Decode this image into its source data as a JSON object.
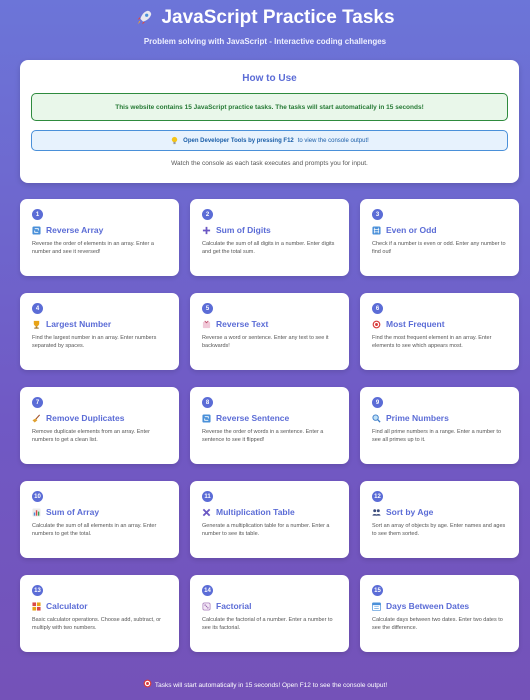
{
  "header": {
    "title": "JavaScript Practice Tasks",
    "subtitle": "Problem solving with JavaScript - Interactive coding challenges"
  },
  "how_to": {
    "heading": "How to Use",
    "notice": "This website contains 15 JavaScript practice tasks. The tasks will start automatically in 15 seconds!",
    "devtools_strong": "Open Developer Tools by pressing F12",
    "devtools_rest": "to view the console output!",
    "watch": "Watch the console as each task executes and prompts you for input."
  },
  "tasks": [
    {
      "num": "1",
      "title": "Reverse Array",
      "icon": "reverse-icon",
      "desc": "Reverse the order of elements in an array. Enter a number and see it reversed!"
    },
    {
      "num": "2",
      "title": "Sum of Digits",
      "icon": "plus-icon",
      "desc": "Calculate the sum of all digits in a number. Enter digits and get the total sum."
    },
    {
      "num": "3",
      "title": "Even or Odd",
      "icon": "numbers-icon",
      "desc": "Check if a number is even or odd. Enter any number to find out!"
    },
    {
      "num": "4",
      "title": "Largest Number",
      "icon": "trophy-icon",
      "desc": "Find the largest number in an array. Enter numbers separated by spaces."
    },
    {
      "num": "5",
      "title": "Reverse Text",
      "icon": "text-icon",
      "desc": "Reverse a word or sentence. Enter any text to see it backwards!"
    },
    {
      "num": "6",
      "title": "Most Frequent",
      "icon": "target-icon",
      "desc": "Find the most frequent element in an array. Enter elements to see which appears most."
    },
    {
      "num": "7",
      "title": "Remove Duplicates",
      "icon": "broom-icon",
      "desc": "Remove duplicate elements from an array. Enter numbers to get a clean list."
    },
    {
      "num": "8",
      "title": "Reverse Sentence",
      "icon": "reverse-icon",
      "desc": "Reverse the order of words in a sentence. Enter a sentence to see it flipped!"
    },
    {
      "num": "9",
      "title": "Prime Numbers",
      "icon": "magnifier-icon",
      "desc": "Find all prime numbers in a range. Enter a number to see all primes up to it."
    },
    {
      "num": "10",
      "title": "Sum of Array",
      "icon": "bar-chart-icon",
      "desc": "Calculate the sum of all elements in an array. Enter numbers to get the total."
    },
    {
      "num": "11",
      "title": "Multiplication Table",
      "icon": "multiply-icon",
      "desc": "Generate a multiplication table for a number. Enter a number to see its table."
    },
    {
      "num": "12",
      "title": "Sort by Age",
      "icon": "people-icon",
      "desc": "Sort an array of objects by age. Enter names and ages to see them sorted."
    },
    {
      "num": "13",
      "title": "Calculator",
      "icon": "calculator-icon",
      "desc": "Basic calculator operations. Choose add, subtract, or multiply with two numbers."
    },
    {
      "num": "14",
      "title": "Factorial",
      "icon": "dice-icon",
      "desc": "Calculate the factorial of a number. Enter a number to see its factorial."
    },
    {
      "num": "15",
      "title": "Days Between Dates",
      "icon": "calendar-icon",
      "desc": "Calculate days between two dates. Enter two dates to see the difference."
    }
  ],
  "footer": "Tasks will start automatically in 15 seconds! Open F12 to see the console output!",
  "colors": {
    "accent": "#5b6cd6",
    "success": "#267a35",
    "info": "#1b5ea8"
  }
}
